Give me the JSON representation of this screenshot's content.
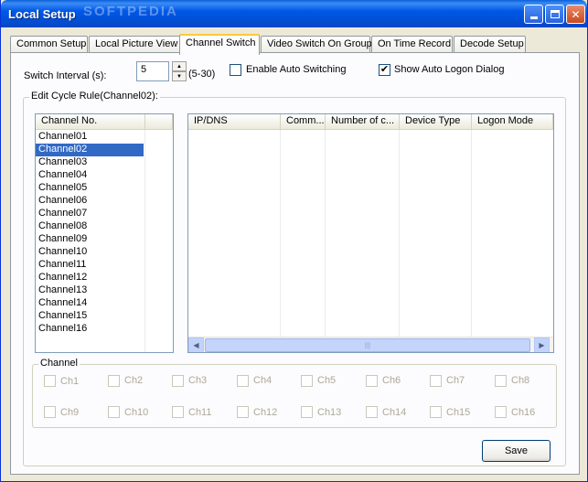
{
  "window": {
    "title": "Local Setup",
    "watermark": "SOFTPEDIA"
  },
  "tabs": [
    {
      "label": "Common Setup"
    },
    {
      "label": "Local Picture View"
    },
    {
      "label": "Channel Switch"
    },
    {
      "label": "Video Switch On Group"
    },
    {
      "label": "On Time Record"
    },
    {
      "label": "Decode Setup"
    }
  ],
  "switch": {
    "interval_label": "Switch Interval (s):",
    "interval_value": "5",
    "range_hint": "(5-30)",
    "auto_switching_label": "Enable Auto Switching",
    "auto_switching_checked": false,
    "auto_logon_label": "Show Auto Logon Dialog",
    "auto_logon_checked": true
  },
  "cycle": {
    "group_title": "Edit Cycle Rule(Channel02):",
    "channel_header": "Channel No.",
    "channels": [
      "Channel01",
      "Channel02",
      "Channel03",
      "Channel04",
      "Channel05",
      "Channel06",
      "Channel07",
      "Channel08",
      "Channel09",
      "Channel10",
      "Channel11",
      "Channel12",
      "Channel13",
      "Channel14",
      "Channel15",
      "Channel16"
    ],
    "selected_channel": "Channel02",
    "columns": [
      "IP/DNS",
      "Comm...",
      "Number of c...",
      "Device Type",
      "Logon Mode"
    ]
  },
  "channel_group": {
    "title": "Channel",
    "items": [
      "Ch1",
      "Ch2",
      "Ch3",
      "Ch4",
      "Ch5",
      "Ch6",
      "Ch7",
      "Ch8",
      "Ch9",
      "Ch10",
      "Ch11",
      "Ch12",
      "Ch13",
      "Ch14",
      "Ch15",
      "Ch16"
    ]
  },
  "buttons": {
    "save": "Save"
  }
}
